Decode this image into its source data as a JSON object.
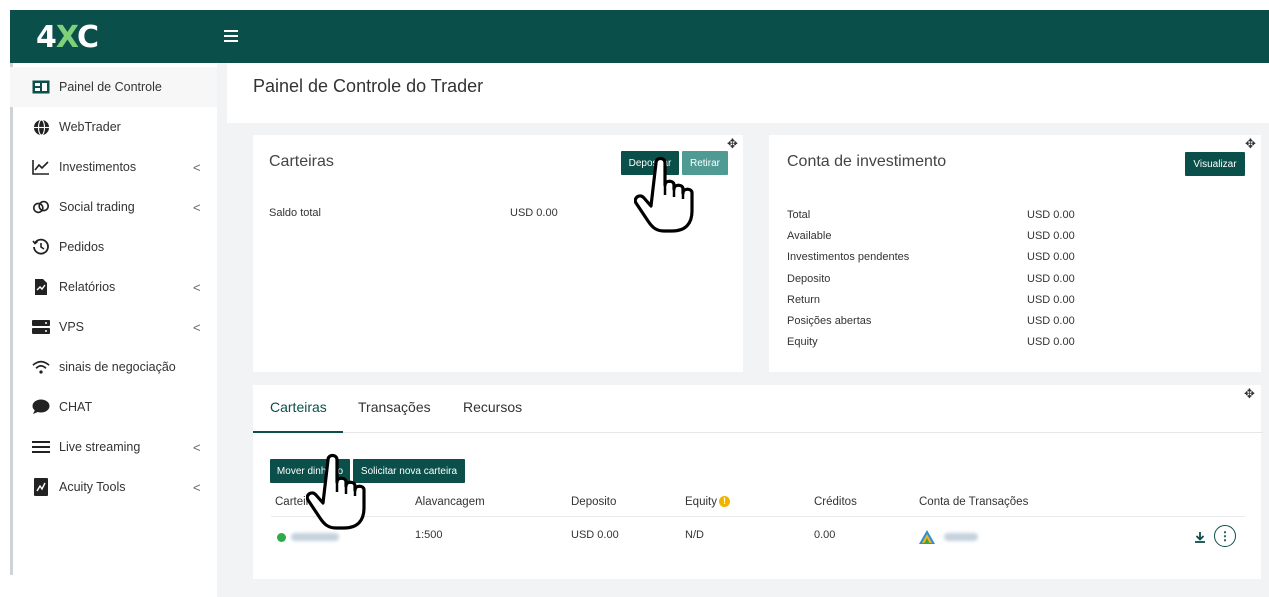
{
  "brand": {
    "logo_left": "4",
    "logo_x": "X",
    "logo_right": "C"
  },
  "colors": {
    "primary": "#0b4f4a",
    "primary_light": "#4f9b94",
    "status_green": "#2eaa4a",
    "warning": "#f0b400"
  },
  "sidebar": {
    "items": [
      {
        "label": "Painel de Controle",
        "icon": "dashboard-icon",
        "active": true,
        "has_submenu": false
      },
      {
        "label": "WebTrader",
        "icon": "globe-icon",
        "active": false,
        "has_submenu": false
      },
      {
        "label": "Investimentos",
        "icon": "chart-line-icon",
        "active": false,
        "has_submenu": true
      },
      {
        "label": "Social trading",
        "icon": "link-icon",
        "active": false,
        "has_submenu": true
      },
      {
        "label": "Pedidos",
        "icon": "history-icon",
        "active": false,
        "has_submenu": false
      },
      {
        "label": "Relatórios",
        "icon": "report-icon",
        "active": false,
        "has_submenu": true
      },
      {
        "label": "VPS",
        "icon": "server-icon",
        "active": false,
        "has_submenu": true
      },
      {
        "label": "sinais de negociação",
        "icon": "wifi-icon",
        "active": false,
        "has_submenu": false
      },
      {
        "label": "CHAT",
        "icon": "chat-icon",
        "active": false,
        "has_submenu": false
      },
      {
        "label": "Live streaming",
        "icon": "list-icon",
        "active": false,
        "has_submenu": true
      },
      {
        "label": "Acuity Tools",
        "icon": "tools-icon",
        "active": false,
        "has_submenu": true
      }
    ],
    "chevron": "<"
  },
  "page": {
    "title": "Painel de Controle do Trader"
  },
  "wallets_card": {
    "title": "Carteiras",
    "deposit_label": "Depositar",
    "withdraw_label": "Retirar",
    "balance_label": "Saldo total",
    "balance_value": "USD 0.00"
  },
  "investment_card": {
    "title": "Conta de investimento",
    "view_label": "Visualizar",
    "rows": [
      {
        "label": "Total",
        "value": "USD 0.00"
      },
      {
        "label": "Available",
        "value": "USD 0.00"
      },
      {
        "label": "Investimentos pendentes",
        "value": "USD 0.00"
      },
      {
        "label": "Deposito",
        "value": "USD 0.00"
      },
      {
        "label": "Return",
        "value": "USD 0.00"
      },
      {
        "label": "Posições abertas",
        "value": "USD 0.00"
      },
      {
        "label": "Equity",
        "value": "USD 0.00"
      }
    ]
  },
  "tabs_card": {
    "tabs": [
      "Carteiras",
      "Transações",
      "Recursos"
    ],
    "move_money_label": "Mover dinheiro",
    "request_wallet_label": "Solicitar nova carteira",
    "columns": [
      "Carteira",
      "Alavancagem",
      "Deposito",
      "Equity",
      "Créditos",
      "Conta de Transações"
    ],
    "row": {
      "wallet": "",
      "leverage": "1:500",
      "deposit": "USD 0.00",
      "equity": "N/D",
      "credits": "0.00",
      "account": ""
    }
  }
}
